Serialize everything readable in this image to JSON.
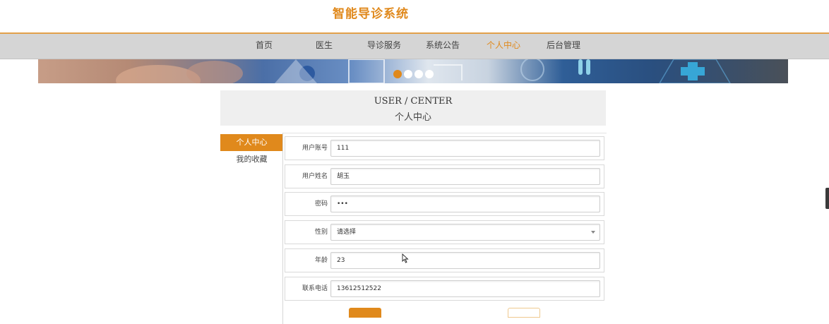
{
  "site": {
    "title": "智能导诊系统"
  },
  "nav": {
    "items": [
      {
        "label": "首页"
      },
      {
        "label": "医生"
      },
      {
        "label": "导诊服务"
      },
      {
        "label": "系统公告"
      },
      {
        "label": "个人中心"
      },
      {
        "label": "后台管理"
      }
    ],
    "active_index": 4,
    "accent_color": "#e0891c"
  },
  "carousel": {
    "slide_count": 4,
    "active_index": 0
  },
  "center": {
    "title_en": "USER / CENTER",
    "title_cn": "个人中心"
  },
  "sidebar": {
    "items": [
      {
        "label": "个人中心"
      },
      {
        "label": "我的收藏"
      }
    ],
    "active_index": 0
  },
  "form": {
    "fields": [
      {
        "label": "用户账号",
        "value": "111"
      },
      {
        "label": "用户姓名",
        "value": "胡玉"
      },
      {
        "label": "密码",
        "value": "•••"
      },
      {
        "label": "性别",
        "value": "请选择"
      },
      {
        "label": "年龄",
        "value": "23"
      },
      {
        "label": "联系电话",
        "value": "13612512522"
      }
    ]
  },
  "icons": {
    "cursor": "mouse-pointer-icon",
    "select_arrow": "chevron-down-icon"
  }
}
